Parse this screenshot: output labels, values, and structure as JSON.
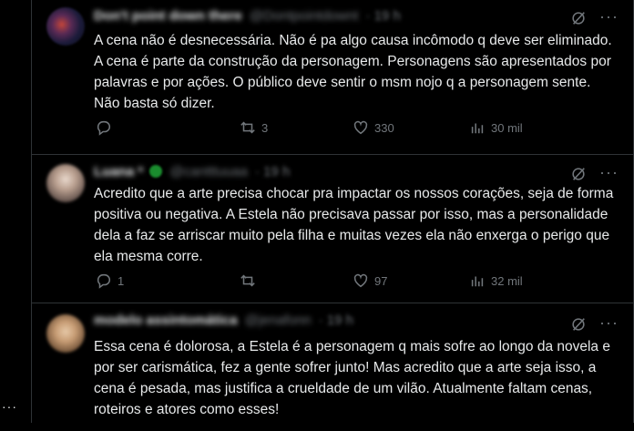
{
  "rail": {
    "more_label": "···"
  },
  "tweets": [
    {
      "name": "Don't point down there",
      "handle": "@Dontpointdownt",
      "time": "· 19 h",
      "body": "A cena não é desnecessária. Não é pa algo causa incômodo q deve ser eliminado. A cena é parte da construção da personagem. Personagens são apresentados por palavras e por ações. O público deve sentir o msm nojo q a personagem sente. Não basta só dizer.",
      "replies": "",
      "retweets": "3",
      "likes": "330",
      "views": "30 mil"
    },
    {
      "name": "Luana *",
      "handle": "@cantttuuaa",
      "time": "· 19 h",
      "body": "Acredito que a arte precisa chocar pra impactar os nossos corações, seja de forma positiva ou negativa. A Estela não precisava passar por isso, mas a personalidade dela a faz se arriscar muito pela filha e muitas vezes ela não enxerga o perigo que ela mesma corre.",
      "replies": "1",
      "retweets": "",
      "likes": "97",
      "views": "32 mil"
    },
    {
      "name": "modelo assintomática",
      "handle": "@jenafonn",
      "time": "· 19 h",
      "body": "Essa cena é dolorosa, a Estela é a personagem q mais sofre ao longo da novela e por ser carismática, fez a gente sofrer junto! Mas acredito que a arte seja isso, a cena é pesada, mas justifica a crueldade de um vilão. Atualmente faltam cenas, roteiros e atores como esses!"
    }
  ],
  "icons": {
    "more": "···"
  },
  "colors": {
    "background": "#000000",
    "text": "#e7e9ea",
    "muted": "#71767b",
    "border": "#2f3336"
  }
}
